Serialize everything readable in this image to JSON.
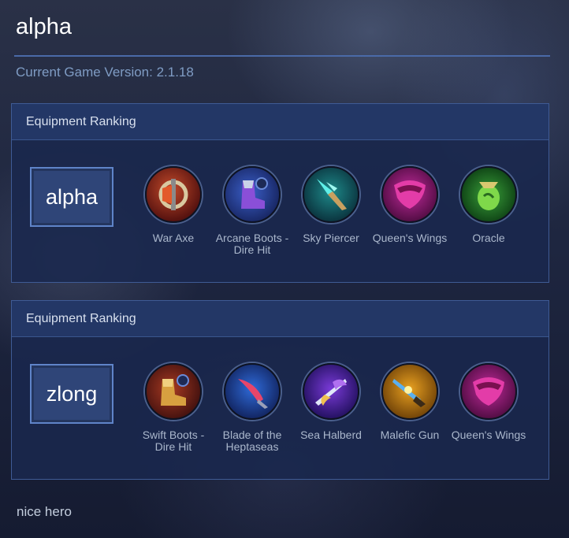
{
  "page": {
    "hero_name": "alpha",
    "version_text": "Current Game Version: 2.1.18",
    "footer_note": "nice hero"
  },
  "cards": [
    {
      "header": "Equipment Ranking",
      "hero": "alpha",
      "items": [
        {
          "name": "War Axe",
          "icon": "war-axe-icon"
        },
        {
          "name": "Arcane Boots - Dire Hit",
          "icon": "arcane-boots-icon"
        },
        {
          "name": "Sky Piercer",
          "icon": "sky-piercer-icon"
        },
        {
          "name": "Queen's Wings",
          "icon": "queens-wings-icon"
        },
        {
          "name": "Oracle",
          "icon": "oracle-icon"
        }
      ]
    },
    {
      "header": "Equipment Ranking",
      "hero": "zlong",
      "items": [
        {
          "name": "Swift Boots - Dire Hit",
          "icon": "swift-boots-icon"
        },
        {
          "name": "Blade of the Heptaseas",
          "icon": "blade-heptaseas-icon"
        },
        {
          "name": "Sea Halberd",
          "icon": "sea-halberd-icon"
        },
        {
          "name": "Malefic Gun",
          "icon": "malefic-gun-icon"
        },
        {
          "name": "Queen's Wings",
          "icon": "queens-wings-icon"
        }
      ]
    }
  ],
  "colors": {
    "accent_border": "#3f5b95",
    "header_bg": "#243868",
    "hero_button": "#2f4578",
    "version_text": "#7f9cc4"
  }
}
